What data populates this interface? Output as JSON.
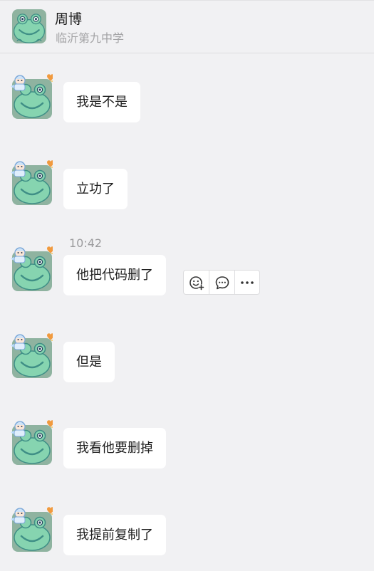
{
  "header": {
    "name": "周博",
    "organization": "临沂第九中学"
  },
  "messages": [
    {
      "text": "我是不是"
    },
    {
      "text": "立功了"
    },
    {
      "text": "他把代码删了",
      "timestamp": "10:42"
    },
    {
      "text": "但是"
    },
    {
      "text": "我看他要删掉"
    },
    {
      "text": "我提前复制了"
    }
  ],
  "message_actions": {
    "icons": [
      "add-reaction-icon",
      "reply-icon",
      "more-icon"
    ]
  },
  "colors": {
    "background": "#f1f1f3",
    "bubble": "#ffffff",
    "frog_green": "#86d4b0",
    "frog_outline": "#3f8f86",
    "avatar_bg": "#8fb3a0"
  }
}
